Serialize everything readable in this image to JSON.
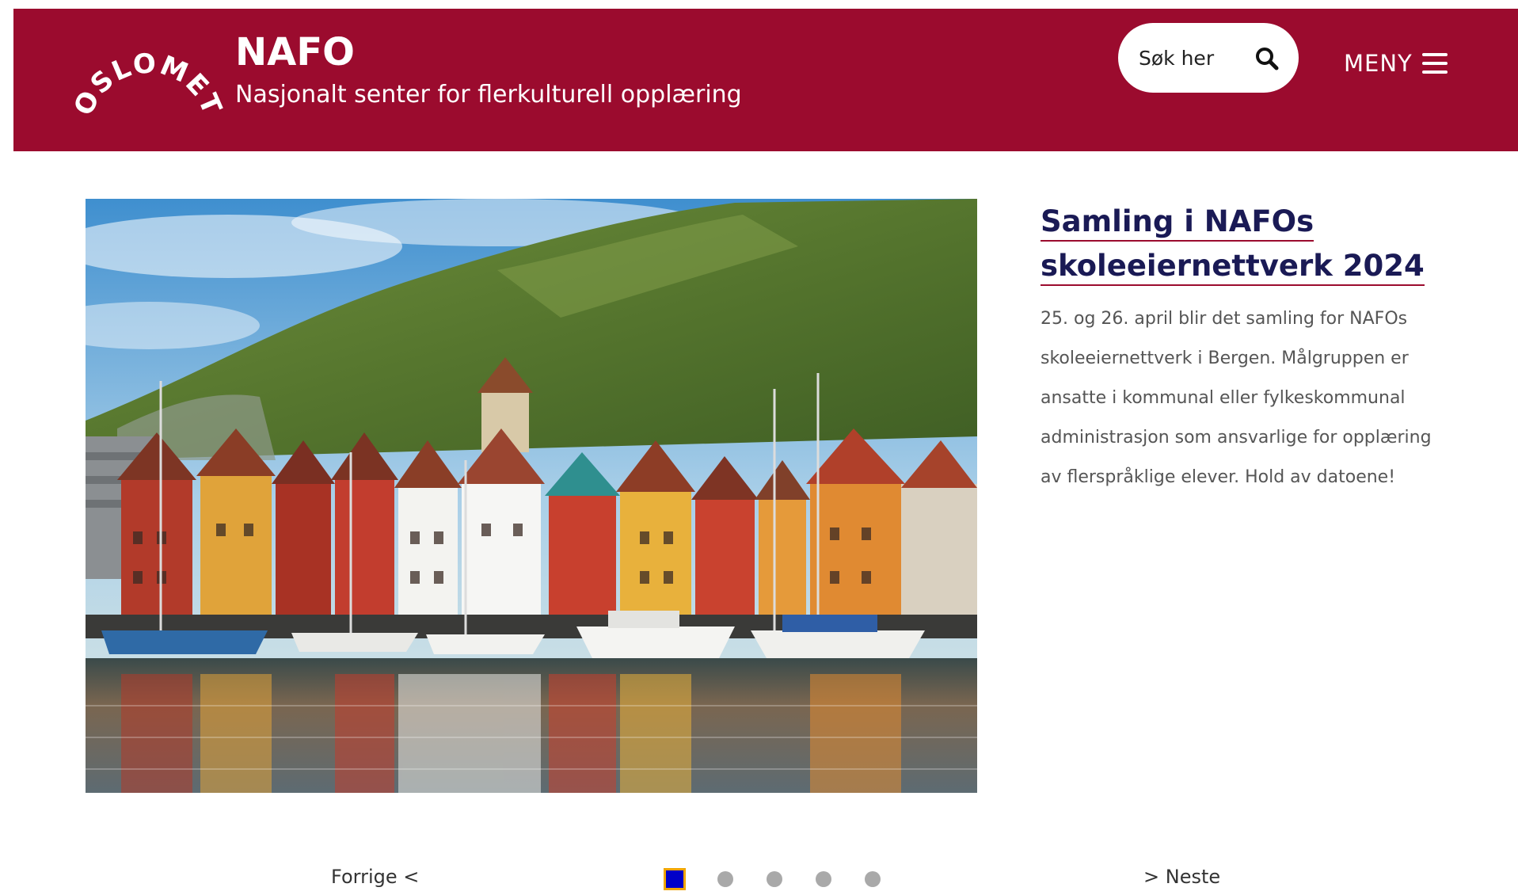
{
  "colors": {
    "brand": "#9b0b2e",
    "title": "#1a1a55",
    "body": "#555555",
    "dot_active": "#0000c8",
    "dot_active_border": "#f0a500",
    "dot_inactive": "#a9a9a9"
  },
  "header": {
    "logo_text": "OSLOMET",
    "title": "NAFO",
    "subtitle": "Nasjonalt senter for flerkulturell opplæring",
    "search": {
      "placeholder": "Søk her",
      "icon": "search-icon"
    },
    "menu": {
      "label": "MENY",
      "icon": "hamburger-icon"
    }
  },
  "slide": {
    "image_alt": "Bryggen i Bergen",
    "title": "Samling i NAFOs skoleeiernettverk 2024",
    "body": "25. og 26. april blir det samling for NAFOs skoleeiernettverk i Bergen. Målgruppen er ansatte i kommunal eller fylkeskommunal administrasjon som ansvarlige for opplæring av flerspråklige elever. Hold av datoene!"
  },
  "carousel": {
    "prev_label": "Forrige <",
    "next_label": "> Neste",
    "dots": [
      {
        "label": "1",
        "active": true
      },
      {
        "label": "2",
        "active": false
      },
      {
        "label": "3",
        "active": false
      },
      {
        "label": "4",
        "active": false
      },
      {
        "label": "5",
        "active": false
      }
    ]
  }
}
